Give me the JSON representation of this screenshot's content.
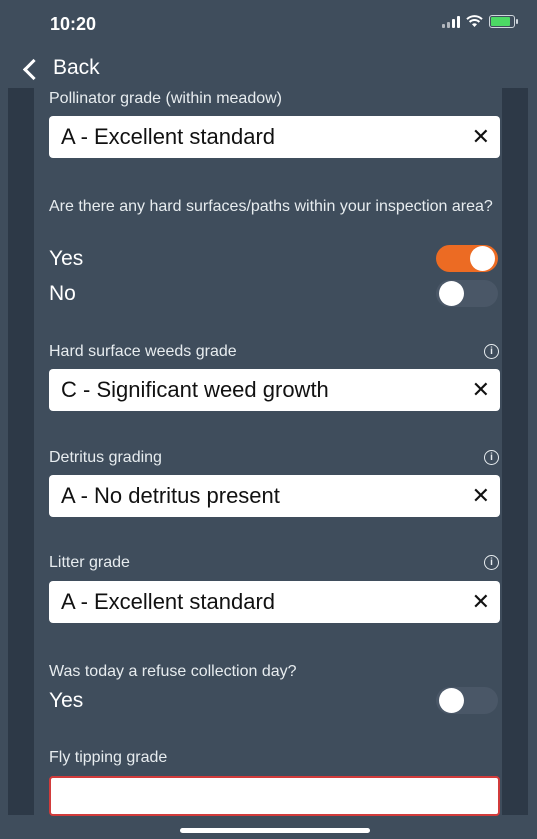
{
  "status": {
    "time": "10:20"
  },
  "nav": {
    "back_label": "Back"
  },
  "pollinator": {
    "label": "Pollinator grade (within meadow)",
    "value": "A - Excellent standard",
    "clear": "✕"
  },
  "hard_surfaces": {
    "question": "Are there any hard surfaces/paths within your inspection area?",
    "yes": "Yes",
    "no": "No",
    "yes_on": true,
    "no_on": false
  },
  "hard_weeds": {
    "label": "Hard surface weeds grade",
    "value": "C - Significant weed growth",
    "clear": "✕"
  },
  "detritus": {
    "label": "Detritus grading",
    "value": "A - No detritus present",
    "clear": "✕"
  },
  "litter": {
    "label": "Litter grade",
    "value": "A - Excellent standard",
    "clear": "✕"
  },
  "refuse": {
    "question": "Was today a refuse collection day?",
    "yes": "Yes",
    "yes_on": false
  },
  "fly_tipping": {
    "label": "Fly tipping grade",
    "value": ""
  },
  "colors": {
    "accent": "#ec6b23",
    "background": "#3f4d5c",
    "error": "#d23b3b"
  }
}
